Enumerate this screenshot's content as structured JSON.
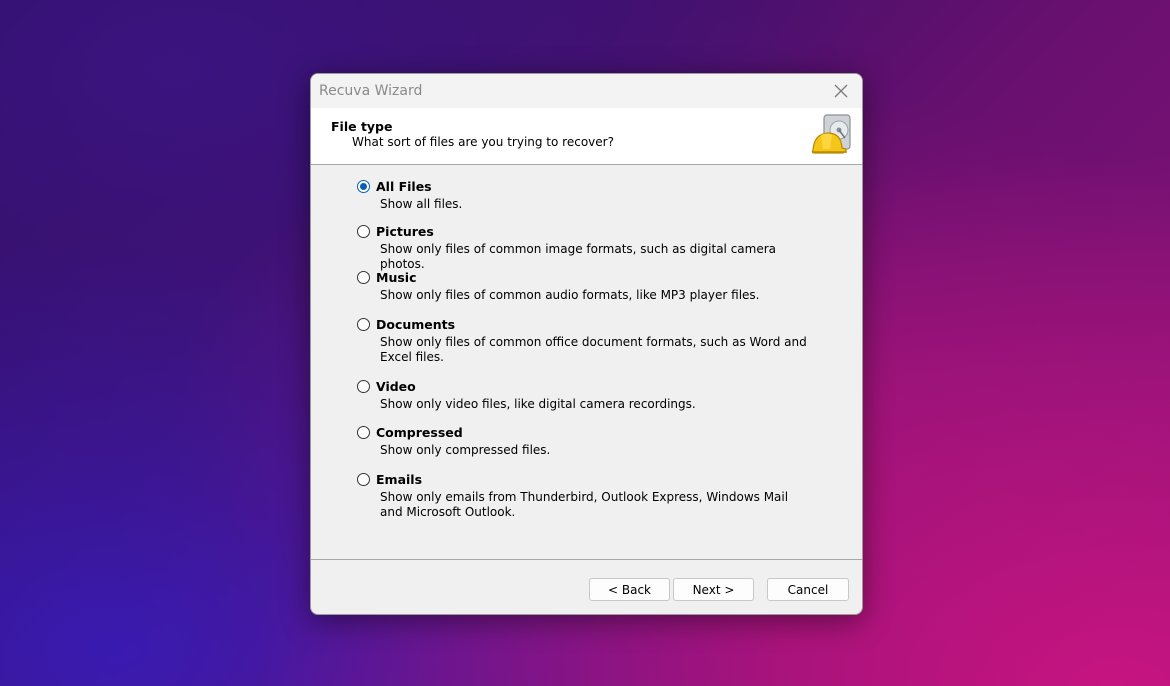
{
  "window": {
    "title": "Recuva Wizard"
  },
  "header": {
    "title": "File type",
    "subtitle": "What sort of files are you trying to recover?",
    "logo_icon": "recuva-hardhat-drive-icon"
  },
  "options": [
    {
      "label": "All Files",
      "description": "Show all files.",
      "selected": true
    },
    {
      "label": "Pictures",
      "description": "Show only files of common image formats, such as digital camera photos.",
      "selected": false
    },
    {
      "label": "Music",
      "description": "Show only files of common audio formats, like MP3 player files.",
      "selected": false
    },
    {
      "label": "Documents",
      "description": "Show only files of common office document formats, such as Word and Excel files.",
      "selected": false
    },
    {
      "label": "Video",
      "description": "Show only video files, like digital camera recordings.",
      "selected": false
    },
    {
      "label": "Compressed",
      "description": "Show only compressed files.",
      "selected": false
    },
    {
      "label": "Emails",
      "description": "Show only emails from Thunderbird, Outlook Express, Windows Mail and Microsoft Outlook.",
      "selected": false
    }
  ],
  "buttons": {
    "back": "< Back",
    "next": "Next >",
    "cancel": "Cancel"
  },
  "colors": {
    "radio_selected": "#0a5fb4",
    "dialog_background": "#f0f0f0",
    "header_background": "#ffffff"
  }
}
